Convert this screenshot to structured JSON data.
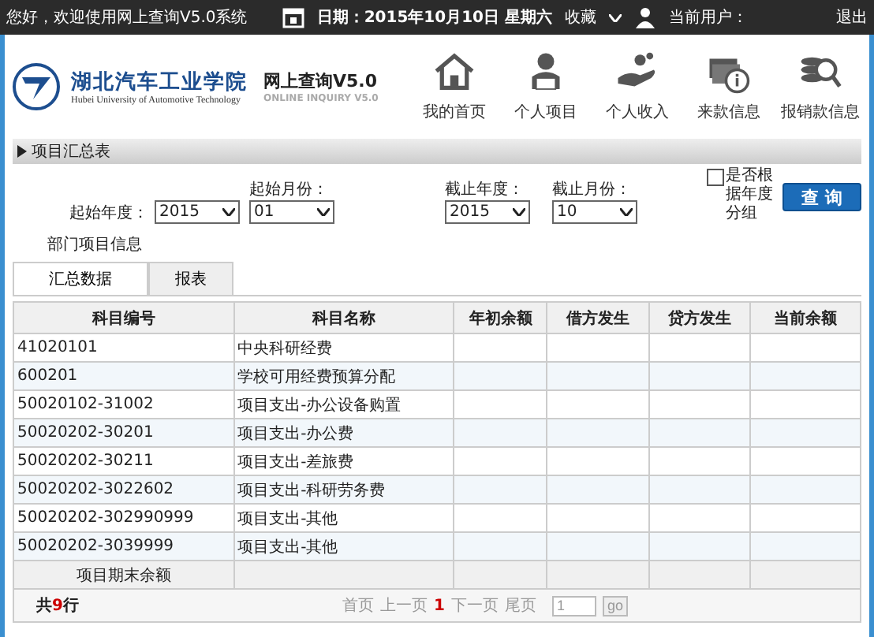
{
  "top_bar": {
    "greeting": "您好，欢迎使用网上查询V5.0系统",
    "date": "日期：2015年10月10日 星期六",
    "favorites": "收藏",
    "user_label": "当前用户：",
    "logout": "退出"
  },
  "header": {
    "school_name": "湖北汽车工业学院",
    "school_name_en": "Hubei University of Automotive Technology",
    "system_title": "网上查询V5.0",
    "system_subtitle": "ONLINE INQUIRY V5.0",
    "nav": [
      {
        "label": "我的首页",
        "kind": "home"
      },
      {
        "label": "个人项目",
        "kind": "project"
      },
      {
        "label": "个人收入",
        "kind": "income"
      },
      {
        "label": "来款信息",
        "kind": "payment"
      },
      {
        "label": "报销款信息",
        "kind": "reimburse"
      }
    ]
  },
  "panel": {
    "title": "项目汇总表"
  },
  "filters": [
    {
      "kind": "inline",
      "label": "起始年度：",
      "value": "2015"
    },
    {
      "kind": "stacked",
      "label": "起始月份：",
      "value": "01"
    },
    {
      "kind": "stacked",
      "label": "截止年度：",
      "value": "2015"
    },
    {
      "kind": "stacked",
      "label": "截止月份：",
      "value": "10"
    }
  ],
  "group_by_year": {
    "label": "是否根据年度分组",
    "checked": false
  },
  "query_button": "查 询",
  "department": {
    "label": "部门项目信息"
  },
  "tabs": [
    {
      "label": "汇总数据",
      "selected": true
    },
    {
      "label": "报表",
      "selected": false
    }
  ],
  "table": {
    "columns": [
      "科目编号",
      "科目名称",
      "年初余额",
      "借方发生",
      "贷方发生",
      "当前余额"
    ],
    "rows": [
      {
        "cells": [
          "41020101",
          "中央科研经费"
        ]
      },
      {
        "cells": [
          "600201",
          "学校可用经费预算分配"
        ]
      },
      {
        "cells": [
          "50020102-31002",
          "项目支出-办公设备购置"
        ]
      },
      {
        "cells": [
          "50020202-30201",
          "项目支出-办公费"
        ]
      },
      {
        "cells": [
          "50020202-30211",
          "项目支出-差旅费"
        ]
      },
      {
        "cells": [
          "50020202-3022602",
          "项目支出-科研劳务费"
        ]
      },
      {
        "cells": [
          "50020202-302990999",
          "项目支出-其他"
        ]
      },
      {
        "cells": [
          "50020202-3039999",
          "项目支出-其他"
        ]
      }
    ],
    "footer": "项目期末余额"
  },
  "pager": {
    "total_prefix": "共",
    "total_count": "9",
    "total_suffix": "行",
    "links": [
      {
        "kind": "link",
        "label": "首页",
        "disabled": true
      },
      {
        "kind": "link",
        "label": "上一页",
        "disabled": true
      },
      {
        "kind": "current",
        "label": "1",
        "disabled": false
      },
      {
        "kind": "link",
        "label": "下一页",
        "disabled": true
      },
      {
        "kind": "link",
        "label": "尾页",
        "disabled": true
      }
    ],
    "page_input": "1",
    "go": "go"
  }
}
